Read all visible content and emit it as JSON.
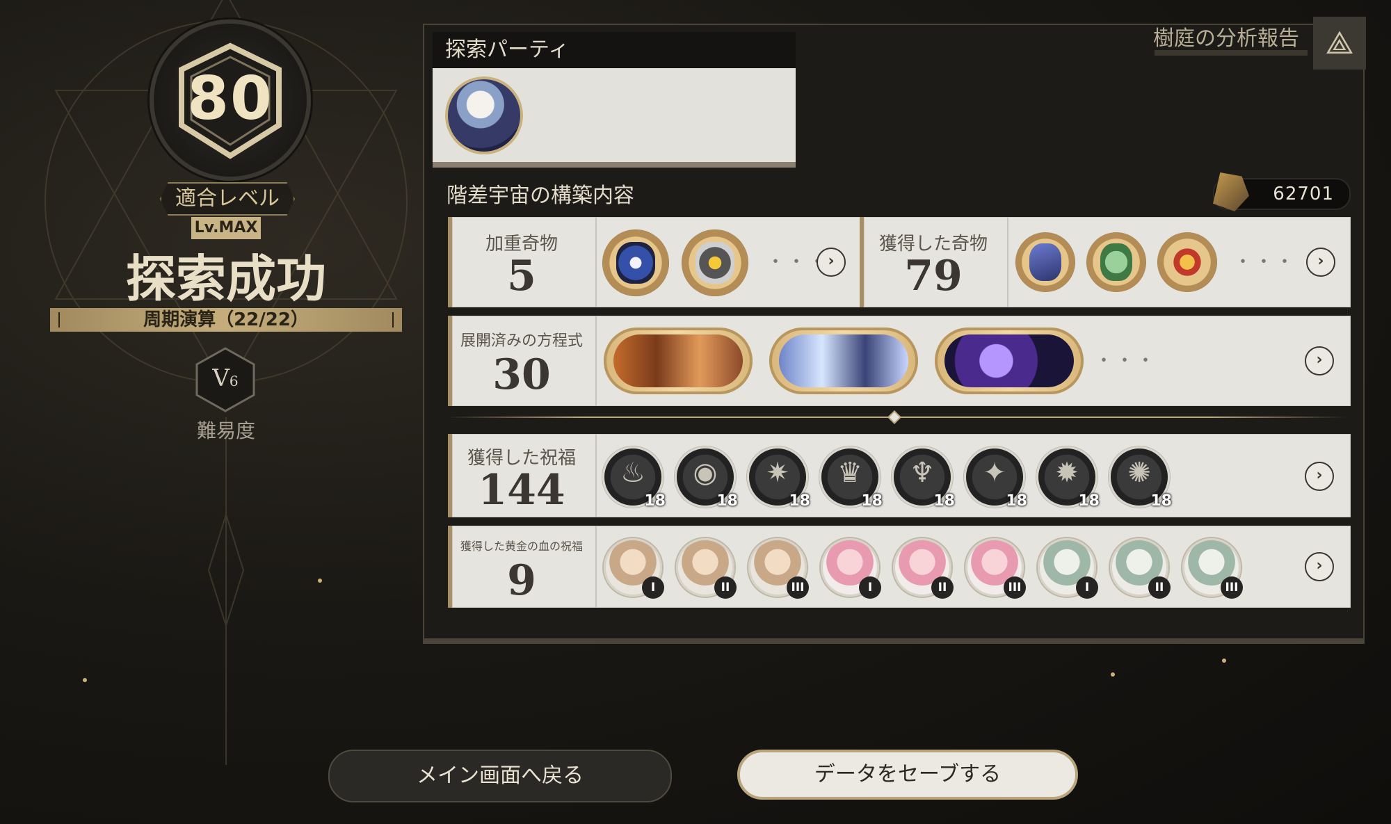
{
  "left": {
    "level": "80",
    "fit_level_label": "適合レベル",
    "lv_max": "Lv.MAX",
    "result": "探索成功",
    "period": "周期演算（22/22）",
    "difficulty_roman": "V",
    "difficulty_sub": "6",
    "difficulty_label": "難易度"
  },
  "header": {
    "report_title": "樹庭の分析報告"
  },
  "party": {
    "title": "探索パーティ"
  },
  "build": {
    "title": "階差宇宙の構築内容",
    "currency": "62701"
  },
  "weighted_curios": {
    "label": "加重奇物",
    "count": "5"
  },
  "obtained_curios": {
    "label": "獲得した奇物",
    "count": "79"
  },
  "equations": {
    "label": "展開済みの方程式",
    "count": "30"
  },
  "blessings": {
    "label": "獲得した祝福",
    "count": "144",
    "levels": [
      "18",
      "18",
      "18",
      "18",
      "18",
      "18",
      "18",
      "18"
    ],
    "icons": [
      "flame-icon",
      "eye-icon",
      "wings-icon",
      "crown-icon",
      "chalice-icon",
      "leaf-icon",
      "gear-icon",
      "swirl-icon"
    ]
  },
  "golden_blood": {
    "label": "獲得した黄金の血の祝福",
    "count": "9",
    "tiers": [
      "I",
      "II",
      "III",
      "I",
      "II",
      "III",
      "I",
      "II",
      "III"
    ]
  },
  "more_dots": "・・・",
  "arrow_glyph": "›",
  "buttons": {
    "back": "メイン画面へ戻る",
    "save": "データをセーブする"
  },
  "colors": {
    "accent_gold": "#c9b488",
    "panel_dark": "#1d1b18",
    "card_bg": "#e6e4df"
  }
}
